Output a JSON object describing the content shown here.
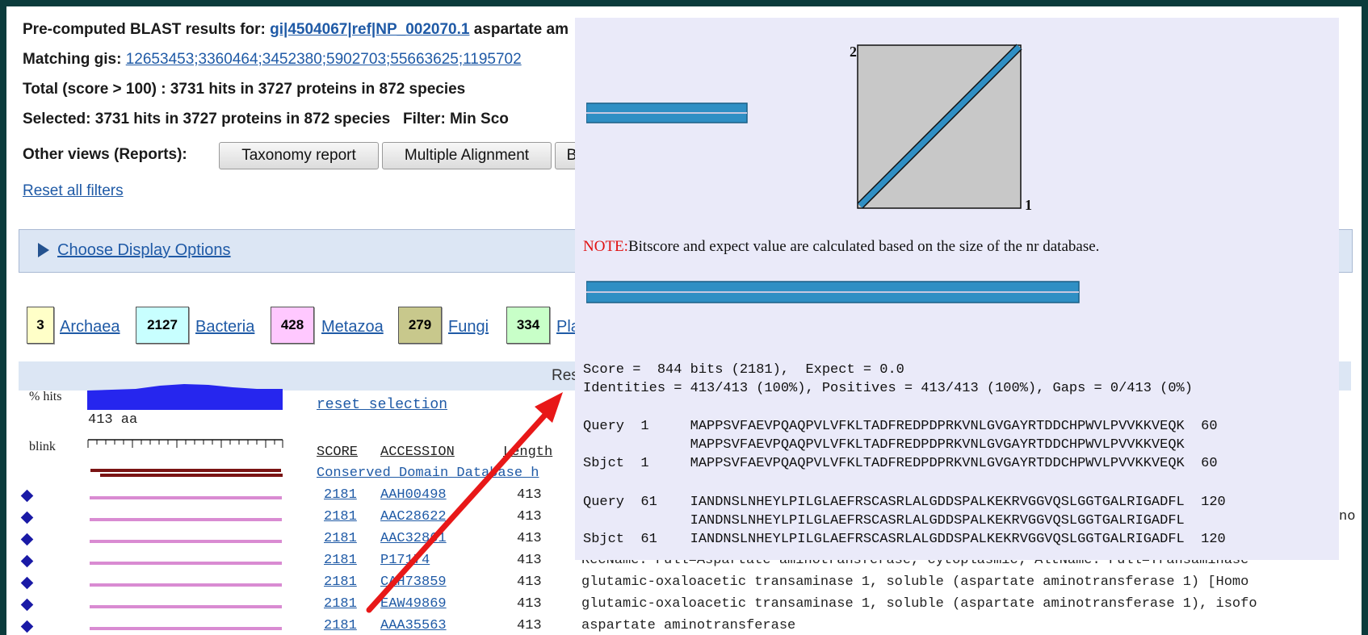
{
  "header": {
    "precomputed_prefix": "Pre-computed BLAST results for:",
    "query_link": "gi|4504067|ref|NP_002070.1",
    "query_desc": "aspartate am",
    "matching_label": "Matching gis:",
    "matching_gis": "12653453;3360464;3452380;5902703;55663625;1195702",
    "total_line": "Total (score > 100) : 3731 hits in 3727 proteins in 872 species",
    "selected_line": "Selected: 3731 hits in 3727 proteins in 872 species   Filter: Min Sco",
    "other_views_label": "Other views (Reports):",
    "buttons": [
      "Taxonomy report",
      "Multiple Alignment",
      "B"
    ],
    "reset_filters": "Reset all filters"
  },
  "display_options": {
    "label": "Choose Display Options"
  },
  "taxa": [
    {
      "count": "3",
      "name": "Archaea",
      "color": "#ffffc8"
    },
    {
      "count": "2127",
      "name": "Bacteria",
      "color": "#c8ffff"
    },
    {
      "count": "428",
      "name": "Metazoa",
      "color": "#ffc8ff"
    },
    {
      "count": "279",
      "name": "Fungi",
      "color": "#c8c88c"
    },
    {
      "count": "334",
      "name": "Pla",
      "color": "#c8ffc8"
    }
  ],
  "results_bar": "Res",
  "graph": {
    "hits_label": "% hits",
    "length_label": "413 aa",
    "blink_label": "blink",
    "reset_selection": "reset selection"
  },
  "table": {
    "headers": {
      "score": "SCORE",
      "accession": "ACCESSION",
      "length": "Length"
    },
    "cdd_link": "Conserved Domain Database h",
    "rows": [
      {
        "score": "2181",
        "accession": "AAH00498",
        "length": "413",
        "desc": ""
      },
      {
        "score": "2181",
        "accession": "AAC28622",
        "length": "413",
        "desc": ""
      },
      {
        "score": "2181",
        "accession": "AAC32861",
        "length": "413",
        "desc": ""
      },
      {
        "score": "2181",
        "accession": "P17174",
        "length": "413",
        "desc": "RecName: Full=Aspartate aminotransferase, cytoplasmic; AltName: Full=Transaminase"
      },
      {
        "score": "2181",
        "accession": "CAH73859",
        "length": "413",
        "desc": "glutamic-oxaloacetic transaminase 1, soluble (aspartate aminotransferase 1) [Homo"
      },
      {
        "score": "2181",
        "accession": "EAW49869",
        "length": "413",
        "desc": "glutamic-oxaloacetic transaminase 1, soluble (aspartate aminotransferase 1), isofo"
      },
      {
        "score": "2181",
        "accession": "AAA35563",
        "length": "413",
        "desc": "aspartate aminotransferase"
      }
    ],
    "row2_right_fragment": "no"
  },
  "popup": {
    "dotplot_label_top": "2",
    "dotplot_label_right": "1",
    "note_prefix": "NOTE:",
    "note_text": "Bitscore and expect value are calculated based on the size of the nr database.",
    "score_line": "Score =  844 bits (2181),  Expect = 0.0",
    "identities_line": "Identities = 413/413 (100%), Positives = 413/413 (100%), Gaps = 0/413 (0%)",
    "alignment_block1": "Query  1     MAPPSVFAEVPQAQPVLVFKLTADFREDPDPRKVNLGVGAYRTDDCHPWVLPVVKKVEQK  60\n             MAPPSVFAEVPQAQPVLVFKLTADFREDPDPRKVNLGVGAYRTDDCHPWVLPVVKKVEQK\nSbjct  1     MAPPSVFAEVPQAQPVLVFKLTADFREDPDPRKVNLGVGAYRTDDCHPWVLPVVKKVEQK  60",
    "alignment_block2": "Query  61    IANDNSLNHEYLPILGLAEFRSCASRLALGDDSPALKEKRVGGVQSLGGTGALRIGADFL  120\n             IANDNSLNHEYLPILGLAEFRSCASRLALGDDSPALKEKRVGGVQSLGGTGALRIGADFL\nSbjct  61    IANDNSLNHEYLPILGLAEFRSCASRLALGDDSPALKEKRVGGVQSLGGTGALRIGADFL  120"
  },
  "colors": {
    "link": "#1f5aa6",
    "alignment_bar": "#2f8fc4",
    "dotplot_bg": "#c8c8c8",
    "note_red": "#e01010",
    "arrow_red": "#e81818",
    "frame_border": "#0b3b3c"
  }
}
